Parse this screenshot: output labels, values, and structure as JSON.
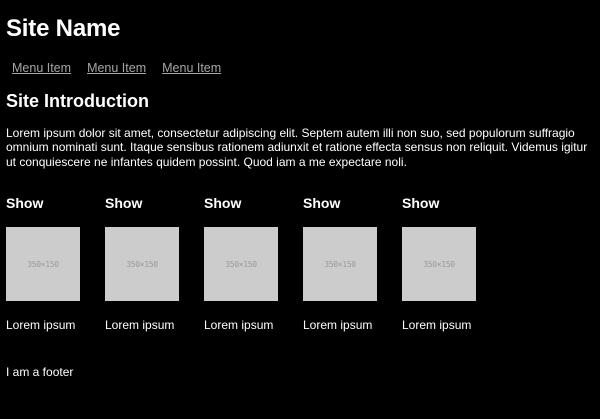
{
  "header": {
    "site_name": "Site Name"
  },
  "nav": {
    "items": [
      {
        "label": "Menu Item"
      },
      {
        "label": "Menu Item"
      },
      {
        "label": "Menu Item"
      }
    ]
  },
  "intro": {
    "heading": "Site Introduction",
    "text": "Lorem ipsum dolor sit amet, consectetur adipiscing elit. Septem autem illi non suo, sed populorum suffragio omnium nominati sunt. Itaque sensibus rationem adiunxit et ratione effecta sensus non reliquit. Videmus igitur ut conquiescere ne infantes quidem possint. Quod iam a me expectare noli."
  },
  "shows": [
    {
      "title": "Show",
      "thumb_text": "350×150",
      "caption": "Lorem ipsum"
    },
    {
      "title": "Show",
      "thumb_text": "350×150",
      "caption": "Lorem ipsum"
    },
    {
      "title": "Show",
      "thumb_text": "350×150",
      "caption": "Lorem ipsum"
    },
    {
      "title": "Show",
      "thumb_text": "350×150",
      "caption": "Lorem ipsum"
    },
    {
      "title": "Show",
      "thumb_text": "350×150",
      "caption": "Lorem ipsum"
    }
  ],
  "footer": {
    "text": "I am a footer"
  },
  "colors": {
    "background": "#000000",
    "text": "#ffffff",
    "nav_link": "#a6a6a6",
    "thumbnail": "#cccccc"
  }
}
